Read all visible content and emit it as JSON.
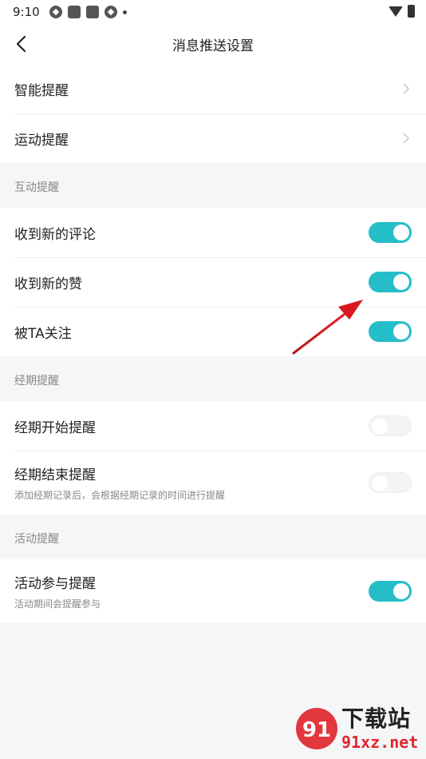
{
  "status_bar": {
    "time": "9:10"
  },
  "header": {
    "title": "消息推送设置"
  },
  "group_main": {
    "items": [
      {
        "label": "智能提醒"
      },
      {
        "label": "运动提醒"
      }
    ]
  },
  "interaction": {
    "header": "互动提醒",
    "items": [
      {
        "label": "收到新的评论",
        "enabled": true
      },
      {
        "label": "收到新的赞",
        "enabled": true
      },
      {
        "label": "被TA关注",
        "enabled": true
      }
    ]
  },
  "period": {
    "header": "经期提醒",
    "items": [
      {
        "label": "经期开始提醒",
        "enabled": false
      },
      {
        "label": "经期结束提醒",
        "sub": "添加经期记录后，会根据经期记录的时间进行提醒",
        "enabled": false
      }
    ]
  },
  "activity": {
    "header": "活动提醒",
    "items": [
      {
        "label": "活动参与提醒",
        "sub": "活动期间会提醒参与",
        "enabled": true
      }
    ]
  },
  "colors": {
    "toggle_on": "#25bdc8",
    "arrow": "#d9161c",
    "background": "#f5f6f8"
  },
  "watermark": {
    "big": "下载站",
    "small": "91xz.net",
    "logo_text": "91"
  }
}
